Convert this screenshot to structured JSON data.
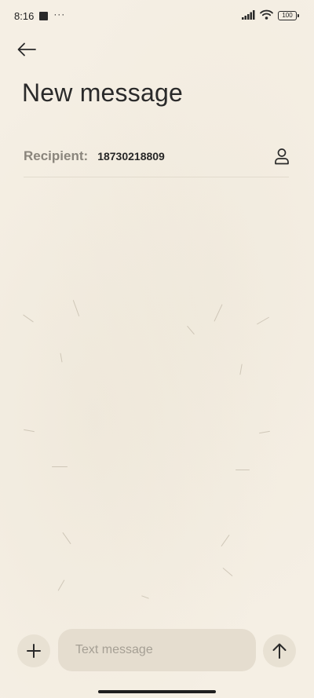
{
  "status_bar": {
    "time": "8:16",
    "dots": "···",
    "battery": "100",
    "icons": [
      "media-square-icon",
      "more-notifications-icon",
      "signal-icon",
      "wifi-icon",
      "battery-icon"
    ]
  },
  "header": {
    "back_icon": "arrow-left-icon",
    "title": "New message"
  },
  "recipient": {
    "label": "Recipient:",
    "value": "18730218809",
    "contact_icon": "person-icon"
  },
  "compose": {
    "add_icon": "plus-icon",
    "placeholder": "Text message",
    "send_icon": "arrow-up-icon"
  },
  "colors": {
    "background": "#f5efe4",
    "input_bg": "#e5ddcf",
    "button_bg": "#e8e1d3",
    "label_gray": "#8a857c"
  }
}
